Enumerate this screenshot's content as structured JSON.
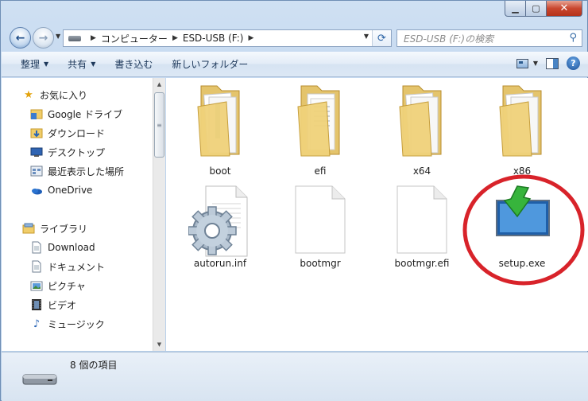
{
  "address": {
    "segments": [
      "コンピューター",
      "ESD-USB (F:)"
    ]
  },
  "search": {
    "placeholder": "ESD-USB (F:)の検索"
  },
  "toolbar": {
    "organize": "整理",
    "share": "共有",
    "burn": "書き込む",
    "new_folder": "新しいフォルダー"
  },
  "sidebar": {
    "favorites_header": "お気に入り",
    "favorites": [
      "Google ドライブ",
      "ダウンロード",
      "デスクトップ",
      "最近表示した場所",
      "OneDrive"
    ],
    "libraries_header": "ライブラリ",
    "libraries": [
      "Download",
      "ドキュメント",
      "ピクチャ",
      "ビデオ",
      "ミュージック"
    ]
  },
  "files": [
    {
      "name": "boot",
      "type": "folder"
    },
    {
      "name": "efi",
      "type": "folder"
    },
    {
      "name": "x64",
      "type": "folder"
    },
    {
      "name": "x86",
      "type": "folder"
    },
    {
      "name": "autorun.inf",
      "type": "settings-file"
    },
    {
      "name": "bootmgr",
      "type": "blank-file"
    },
    {
      "name": "bootmgr.efi",
      "type": "blank-file"
    },
    {
      "name": "setup.exe",
      "type": "installer",
      "highlighted": true
    }
  ],
  "status": {
    "count_text": "8 個の項目"
  },
  "colors": {
    "highlight_circle": "#d8232a",
    "folder": "#f0d27a",
    "accent": "#2b63a4"
  }
}
